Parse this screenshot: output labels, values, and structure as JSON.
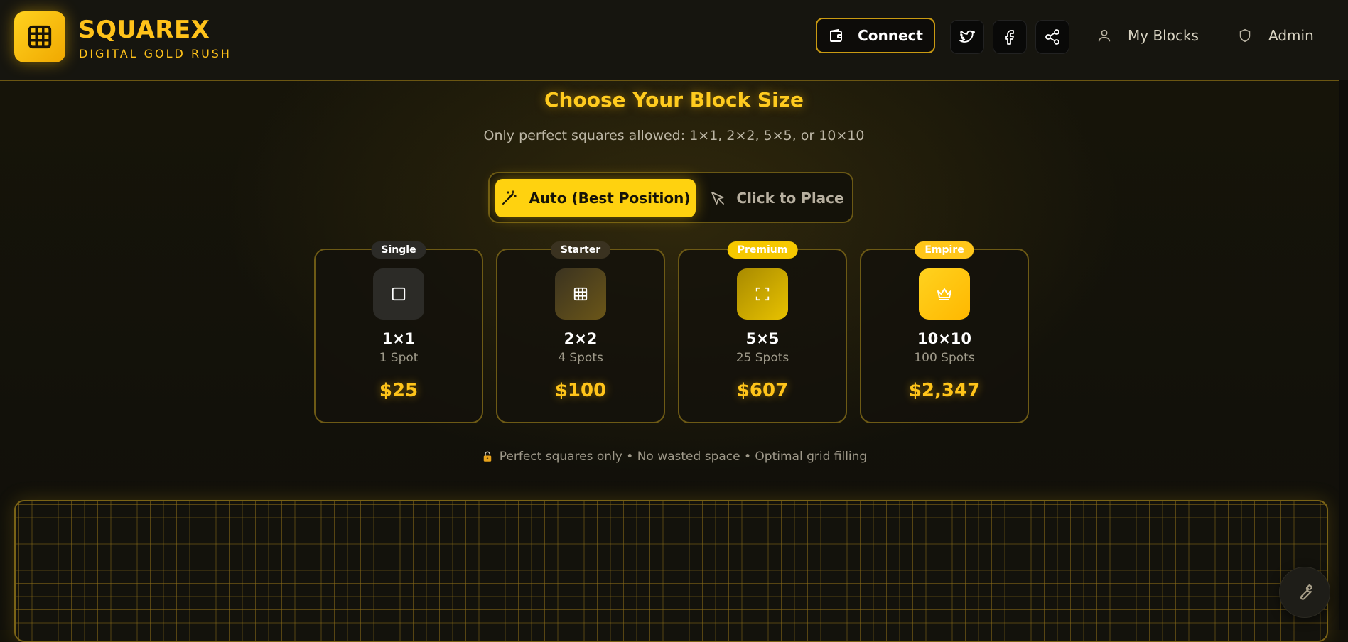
{
  "brand": {
    "title": "SQUAREX",
    "subtitle": "DIGITAL GOLD RUSH",
    "logo_icon": "grid-icon"
  },
  "header": {
    "connect_label": "Connect",
    "connect_icon": "wallet-icon",
    "social_icons": [
      "twitter-icon",
      "facebook-icon",
      "share-icon"
    ],
    "nav": [
      {
        "label": "My Blocks",
        "icon": "user-icon"
      },
      {
        "label": "Admin",
        "icon": "shield-icon"
      }
    ]
  },
  "main": {
    "title": "Choose Your Block Size",
    "subtitle": "Only perfect squares allowed: 1×1, 2×2, 5×5, or 10×10",
    "mode_toggle": {
      "auto_label": "Auto (Best Position)",
      "auto_icon": "magic-wand-icon",
      "click_label": "Click to Place",
      "click_icon": "cursor-icon",
      "selected": "auto"
    },
    "blocks": [
      {
        "badge": "Single",
        "size": "1×1",
        "spots": "1 Spot",
        "price": "$25",
        "icon": "square-icon"
      },
      {
        "badge": "Starter",
        "size": "2×2",
        "spots": "4 Spots",
        "price": "$100",
        "icon": "grid-icon"
      },
      {
        "badge": "Premium",
        "size": "5×5",
        "spots": "25 Spots",
        "price": "$607",
        "icon": "expand-icon"
      },
      {
        "badge": "Empire",
        "size": "10×10",
        "spots": "100 Spots",
        "price": "$2,347",
        "icon": "crown-icon"
      }
    ],
    "footnote": "Perfect squares only • No wasted space • Optimal grid filling",
    "footnote_icon": "lock-icon"
  },
  "fab_icon": "wrench-icon",
  "colors": {
    "accent": "#ffc21a",
    "background": "#141209",
    "border": "#6d5a15"
  }
}
